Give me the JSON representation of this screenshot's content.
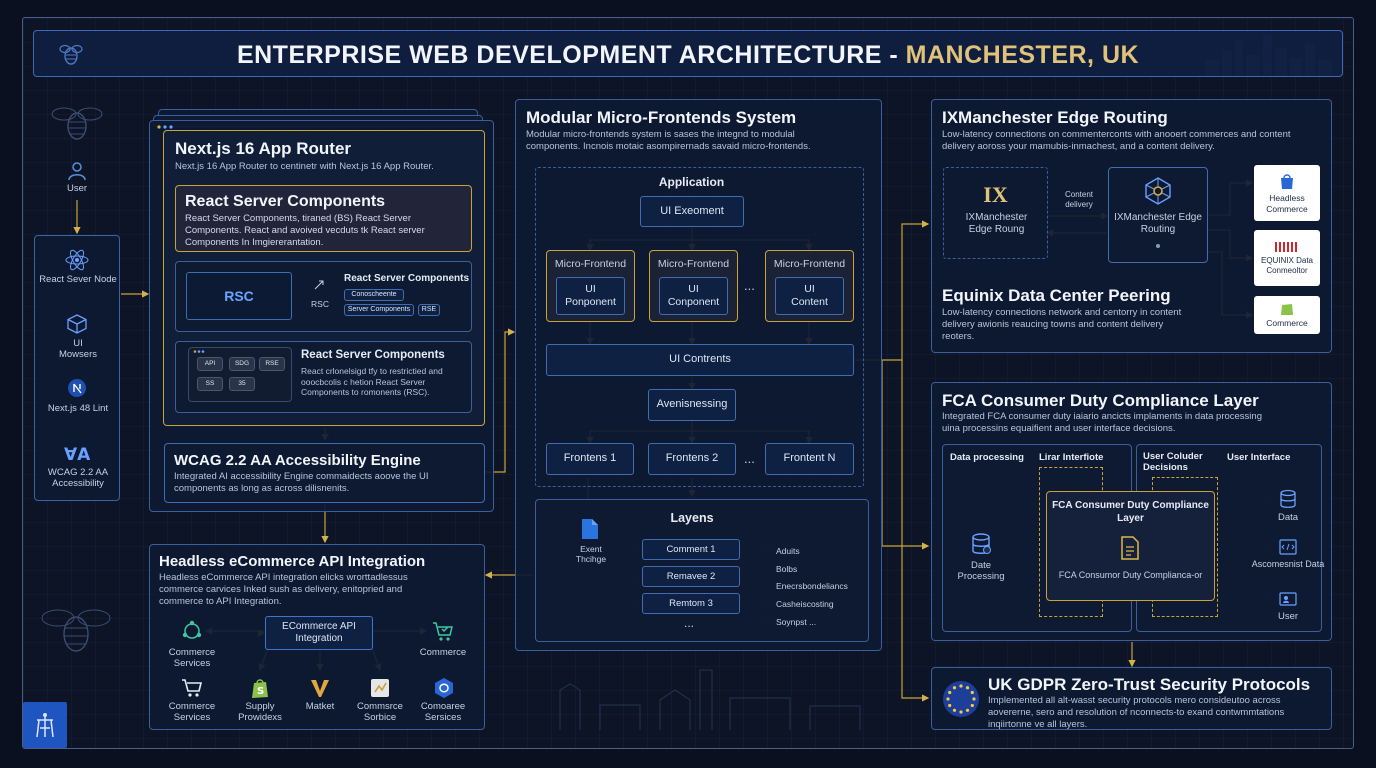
{
  "header": {
    "title_main": "ENTERPRISE WEB DEVELOPMENT ARCHITECTURE - ",
    "title_accent": "MANCHESTER, UK"
  },
  "sidebar": {
    "items": [
      {
        "label": "User",
        "icon": "user-icon"
      },
      {
        "label": "React Sever Node",
        "icon": "atom-icon"
      },
      {
        "label": "UI Mowsers",
        "icon": "cube-icon"
      },
      {
        "label": "Next.js 48 Lint",
        "icon": "nextjs-icon"
      },
      {
        "label": "WCAG 2.2 AA Accessibility",
        "icon": "accessibility-icon"
      }
    ]
  },
  "nextjs": {
    "title": "Next.js 16 App Router",
    "desc": "Next.js 16 App Router to centinetr with Next.js 16 App Router.",
    "rsc": {
      "title": "React Server Components",
      "desc": "React Server Components, tiraned (BS) React Server Components. React and avoived vecduts tk React server Components In Imgiererantation."
    },
    "rsc_diagram": {
      "node": "RSC",
      "arrow_label": "RSC",
      "title": "React Server Components",
      "tags": [
        "Conoscheente",
        "Server Components",
        "RSE"
      ]
    },
    "rsc_api": {
      "title": "React Server Components",
      "desc": "React crlonelsigd tfy to restrictied and ooocbcolis c hetion React Server Components to romonents (RSC).",
      "keys": [
        "API",
        "SDG",
        "RSE",
        "SS",
        "35"
      ]
    }
  },
  "wcag": {
    "title": "WCAG 2.2 AA Accessibility Engine",
    "desc": "Integrated AI accessibility Engine commaidects aoove the UI components as long as across dilisnenits."
  },
  "ecommerce": {
    "title": "Headless eCommerce API Integration",
    "desc": "Headless eCommerce API integration elicks wrorttadlessus commerce carvices Inked sush as delivery, enitopried and commerce to API Integration.",
    "hub": "ECommerce API Integration",
    "left_top": "Commerce Services",
    "right_top": "Commerce",
    "bottom": [
      "Commerce Services",
      "Supply Prowidexs",
      "Matket",
      "Commsrce Sorbice",
      "Comoaree Sersices"
    ]
  },
  "mfe": {
    "title": "Modular Micro-Frontends System",
    "desc": "Modular micro-frontends system is sases the integnd to modulal components. Incnois motaic asompirernads savaid micro-frontends.",
    "application": "Application",
    "ui_exeoment": "UI Exeoment",
    "cards": [
      {
        "label": "Micro-Frontend",
        "inner": "UI Ponponent"
      },
      {
        "label": "Micro-Frontend",
        "inner": "UI Conponent"
      },
      {
        "label": "Micro-Frontend",
        "inner": "UI Content"
      }
    ],
    "ellipsis": "...",
    "ui_contrents": "UI Contrents",
    "avenis": "Avenisnessing",
    "frontends": [
      "Frontens 1",
      "Frontens 2",
      "Frontent N"
    ],
    "layers": {
      "title": "Layens",
      "event": "Exent Thcihge",
      "items": [
        "Comment 1",
        "Remavee 2",
        "Remtom 3"
      ],
      "outputs": [
        "Aduits",
        "Bolbs",
        "Enecrsbondeliancs",
        "Casheiscosting",
        "Soynpst ..."
      ]
    }
  },
  "edge": {
    "title": "IXManchester Edge Routing",
    "desc": "Low-latency connections on commenterconts with anooert commerces and content delivery aoross your mamubis-inmachest, and a content delivery.",
    "ix_logo": "IX",
    "ix_label": "IXManchester Edge Roung",
    "link_label": "Content delivery",
    "hub_label": "IXManchester Edge Routing",
    "partners": [
      "Headless Commerce",
      "EQUINIX Data Conmeoltor",
      "Commerce"
    ],
    "equinix_title": "Equinix Data Center Peering",
    "equinix_desc": "Low-latency connections network and centorry in content delivery awionis reaucing towns and content delivery reoters."
  },
  "fca": {
    "title": "FCA Consumer Duty Compliance Layer",
    "desc": "Integrated FCA consumer duty iaiario ancicts implaments in data processing uina processins equaifient and user interface decisions.",
    "col1": "Data processing",
    "col2": "Lirar Interfiote",
    "col3": "User Coluder Decisions",
    "col4": "User Interface",
    "date_label": "Date Processing",
    "center_title": "FCA Consumer Duty Compliance Layer",
    "center_sub": "FCA Consumor Duty Complianca-or",
    "outputs": [
      "Data",
      "Ascomesnist Data",
      "User"
    ]
  },
  "gdpr": {
    "title": "UK GDPR Zero-Trust Security Protocols",
    "desc": "Implemented all alt-wasst security protocols mero consideutoo across aovererne, sero and resolution of nconnects-to exand contwmmtations inqiirtonne ve all layers."
  },
  "colors": {
    "accent_gold": "#e0c27a",
    "line_blue": "#3f6db0",
    "line_gold": "#c9a23a"
  }
}
